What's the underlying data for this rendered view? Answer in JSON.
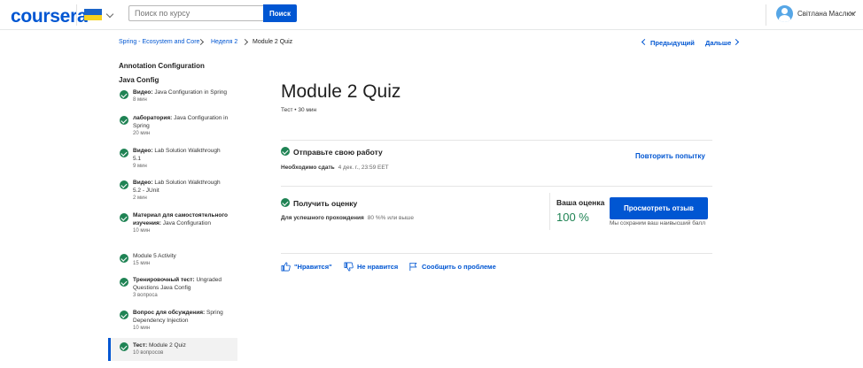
{
  "header": {
    "logo": "coursera",
    "search_placeholder": "Поиск по курсу",
    "search_button": "Поиск",
    "user_name": "Світлана Маслюк",
    "flag_colors": [
      "#1b64c8",
      "#f7d21f"
    ],
    "accent": "#0056d2"
  },
  "breadcrumb": {
    "course": "Spring - Ecosystem and Core",
    "week": "Неделя 2",
    "current": "Module 2 Quiz"
  },
  "nav": {
    "prev": "Предыдущий",
    "next": "Дальше"
  },
  "sidebar": {
    "section": "Annotation Configuration",
    "subsection": "Java Config",
    "items": [
      {
        "type": "Видео:",
        "title": "Java Configuration in Spring",
        "duration": "8 мин"
      },
      {
        "type": "лаборатория:",
        "title": "Java Configuration in Spring",
        "duration": "20 мин"
      },
      {
        "type": "Видео:",
        "title": "Lab Solution Walkthrough 5.1",
        "duration": "9 мин"
      },
      {
        "type": "Видео:",
        "title": "Lab Solution Walkthrough 5.2 - JUnit",
        "duration": "2 мин"
      },
      {
        "type": "Материал для самостоятельного изучения:",
        "title": "Java Configuration",
        "duration": "10 мин"
      },
      {
        "type": "",
        "title": "Module 5 Activity",
        "duration": "15 мин"
      },
      {
        "type": "Тренировочный тест:",
        "title": "Ungraded Questions Java Config",
        "duration": "3 вопроса"
      },
      {
        "type": "Вопрос для обсуждения:",
        "title": "Spring Dependency Injection",
        "duration": "10 мин"
      },
      {
        "type": "Тест:",
        "title": "Module 2 Quiz",
        "duration": "10 вопросов"
      }
    ],
    "status_color": "#1f8354"
  },
  "main": {
    "title": "Module 2 Quiz",
    "subtitle": "Тест • 30 мин",
    "submit": {
      "heading": "Отправьте свою работу",
      "due_label": "Необходимо сдать",
      "due_value": "4 дек. г., 23:59 EET",
      "retry": "Повторить попытку"
    },
    "grade": {
      "heading": "Получить оценку",
      "pass_label": "Для успешного прохождения",
      "pass_value": "80 %% или выше",
      "your_grade_label": "Ваша оценка",
      "your_grade_value": "100 %",
      "review_button": "Просмотреть отзыв",
      "keep_note": "Мы сохраним ваш наивысший балл"
    },
    "actions": {
      "like": "\"Нравится\"",
      "dislike": "Не нравится",
      "report": "Сообщить о проблеме"
    }
  }
}
